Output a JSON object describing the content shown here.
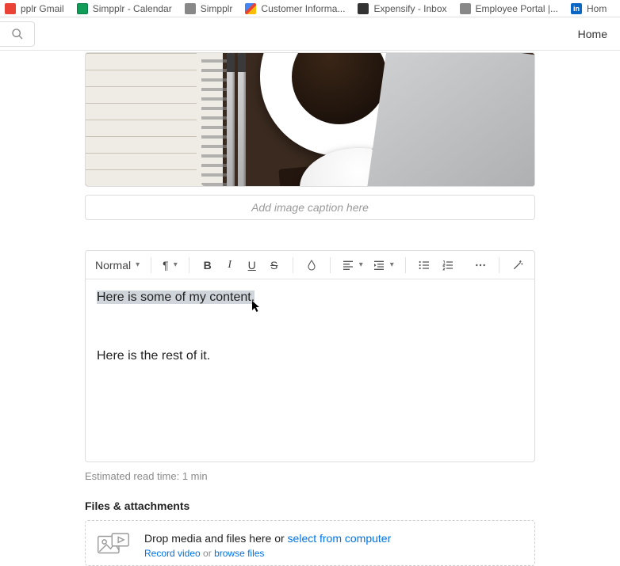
{
  "bookmarks": [
    {
      "label": "pplr Gmail"
    },
    {
      "label": "Simpplr - Calendar"
    },
    {
      "label": "Simpplr"
    },
    {
      "label": "Customer Informa..."
    },
    {
      "label": "Expensify - Inbox"
    },
    {
      "label": "Employee Portal |..."
    },
    {
      "label": "Hom"
    }
  ],
  "header": {
    "home_label": "Home"
  },
  "image": {
    "caption_placeholder": "Add image caption here"
  },
  "toolbar": {
    "style_label": "Normal",
    "paragraph_symbol": "¶",
    "bold": "B",
    "italic": "I",
    "underline": "U",
    "strike": "S"
  },
  "editor": {
    "line1": "Here is some of my content.",
    "line2": "Here is the rest of it."
  },
  "meta": {
    "read_time": "Estimated read time: 1 min"
  },
  "attachments": {
    "heading": "Files & attachments",
    "drop_prefix": "Drop media and files here or ",
    "select_link": "select from computer",
    "record_link": "Record video",
    "or_text": " or ",
    "browse_link": "browse files"
  }
}
